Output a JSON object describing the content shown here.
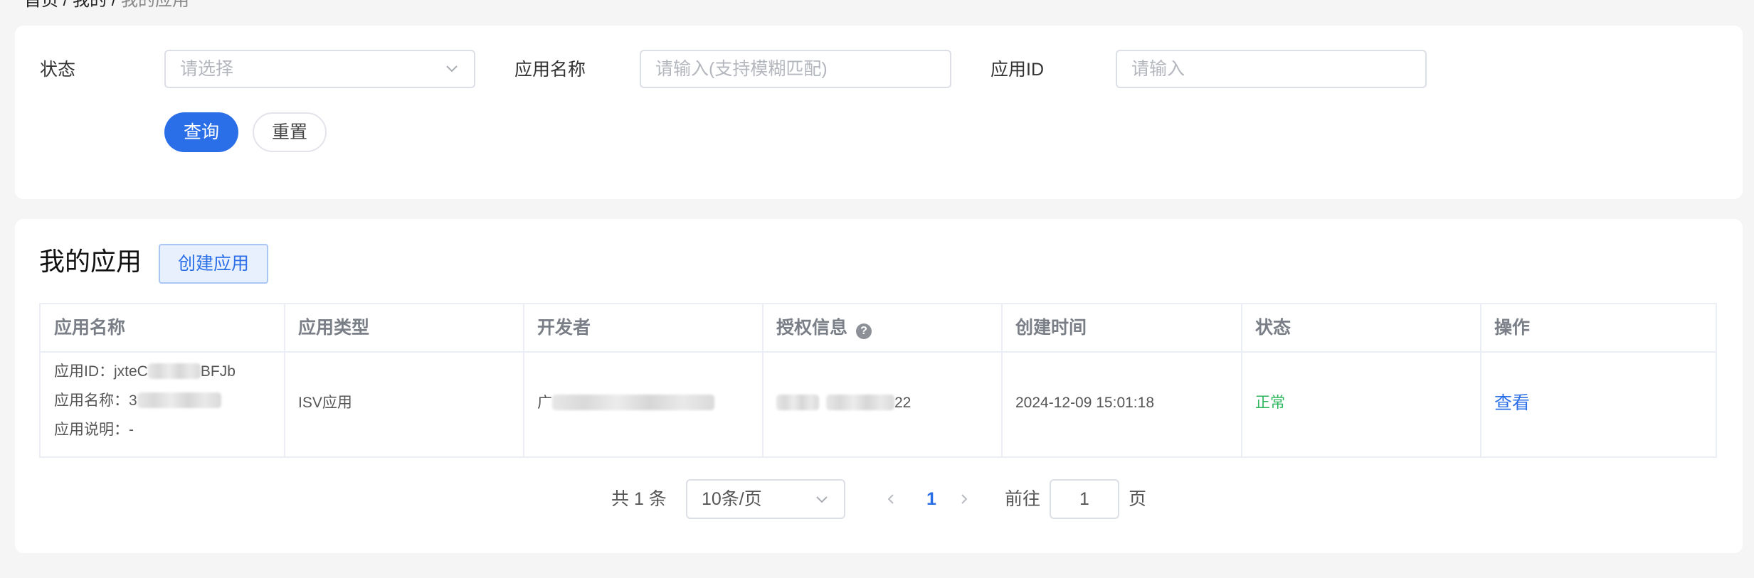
{
  "breadcrumb": {
    "items": [
      "首页",
      "我的"
    ],
    "separator": "/",
    "current": "我的应用"
  },
  "filters": {
    "status": {
      "label": "状态",
      "placeholder": "请选择"
    },
    "app_name": {
      "label": "应用名称",
      "placeholder": "请输入(支持模糊匹配)"
    },
    "app_id": {
      "label": "应用ID",
      "placeholder": "请输入"
    },
    "search_label": "查询",
    "reset_label": "重置"
  },
  "list": {
    "title": "我的应用",
    "create_label": "创建应用",
    "columns": [
      "应用名称",
      "应用类型",
      "开发者",
      "授权信息",
      "创建时间",
      "状态",
      "操作"
    ],
    "rows": [
      {
        "app_id_label": "应用ID：",
        "app_id_prefix": "jxteC",
        "app_id_suffix": "BFJb",
        "app_name_label": "应用名称：",
        "app_name_prefix": "3",
        "app_desc_label": "应用说明：",
        "app_desc": "-",
        "type": "ISV应用",
        "developer_prefix": "广",
        "auth_suffix": "22",
        "created_at": "2024-12-09 15:01:18",
        "status": "正常",
        "action": "查看"
      }
    ]
  },
  "pagination": {
    "total_text": "共 1 条",
    "page_size": "10条/页",
    "current_page": "1",
    "goto_label": "前往",
    "goto_value": "1",
    "goto_unit": "页"
  },
  "colors": {
    "primary": "#2a6fe8",
    "success": "#2db55d",
    "background": "#f5f5f5"
  }
}
